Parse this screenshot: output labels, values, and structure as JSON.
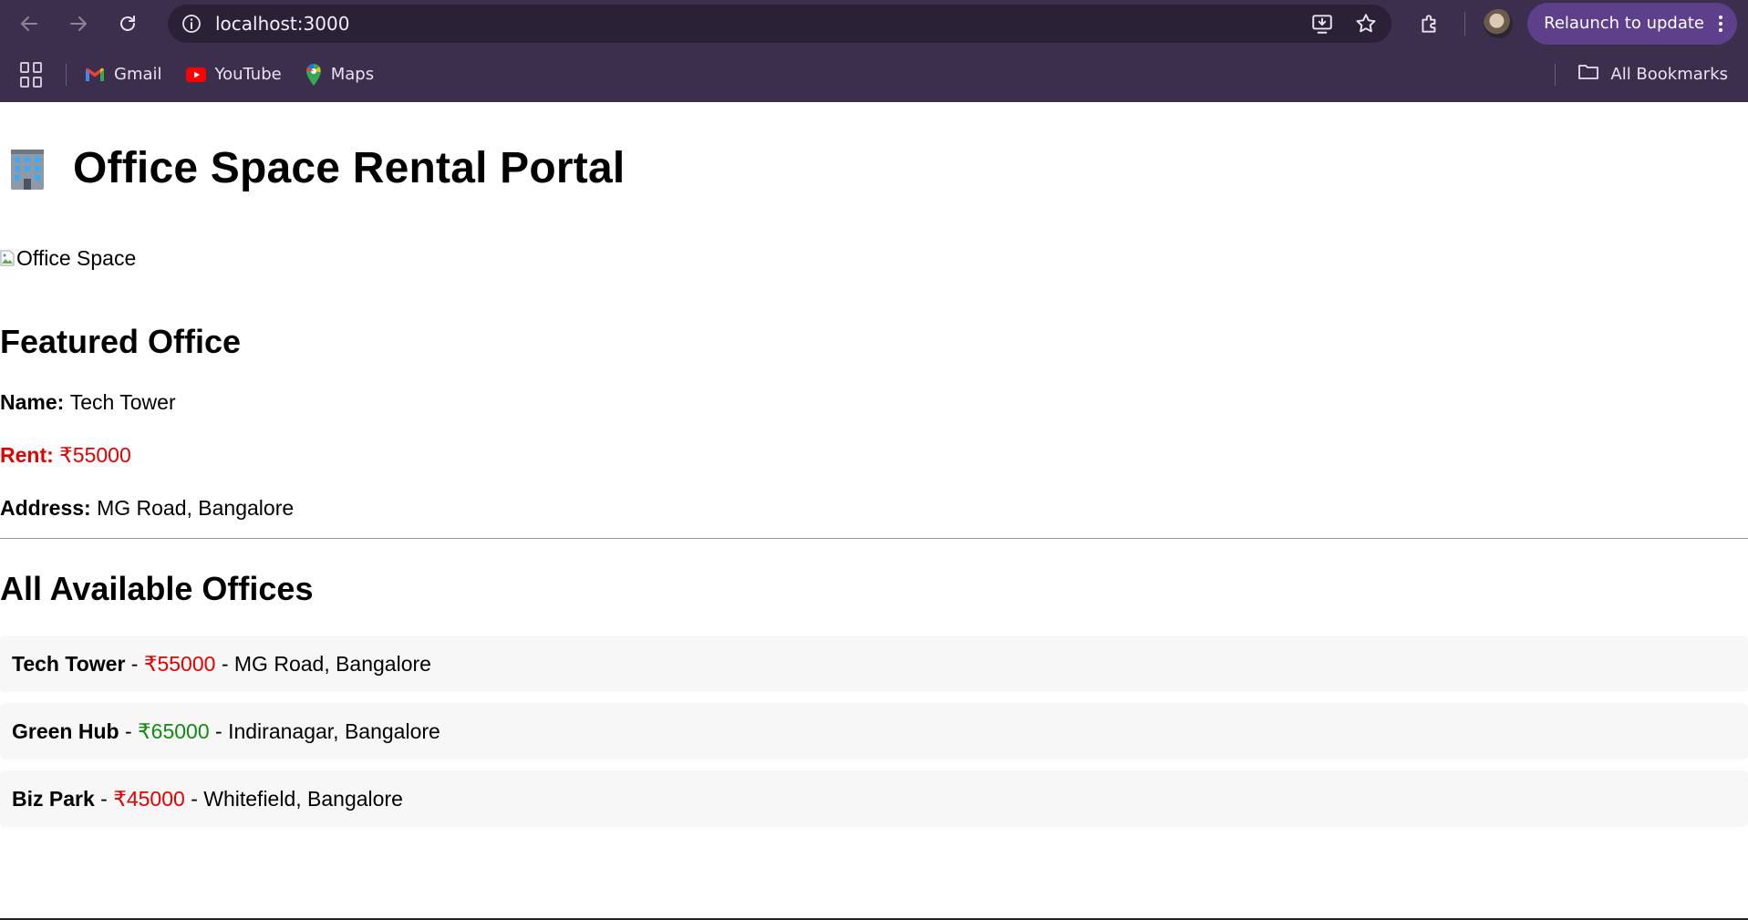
{
  "browser": {
    "url": "localhost:3000",
    "relaunch_label": "Relaunch to update",
    "bookmarks": [
      {
        "label": "Gmail",
        "icon": "gmail-icon"
      },
      {
        "label": "YouTube",
        "icon": "youtube-icon"
      },
      {
        "label": "Maps",
        "icon": "maps-icon"
      }
    ],
    "all_bookmarks_label": "All Bookmarks"
  },
  "page": {
    "title": "Office Space Rental Portal",
    "title_icon": "office-building-emoji",
    "image_alt": "Office Space",
    "featured": {
      "heading": "Featured Office",
      "name_label": "Name:",
      "name_value": "Tech Tower",
      "rent_label": "Rent:",
      "rent_value": "₹55000",
      "address_label": "Address:",
      "address_value": "MG Road, Bangalore"
    },
    "all_heading": "All Available Offices",
    "offices": [
      {
        "name": "Tech Tower",
        "price": "₹55000",
        "address": "MG Road, Bangalore",
        "price_color": "#e60000"
      },
      {
        "name": "Green Hub",
        "price": "₹65000",
        "address": "Indiranagar, Bangalore",
        "price_color": "#138a13"
      },
      {
        "name": "Biz Park",
        "price": "₹45000",
        "address": "Whitefield, Bangalore",
        "price_color": "#e60000"
      }
    ],
    "separator": " - "
  },
  "colors": {
    "chrome_bg": "#3c2f4d",
    "relaunch_bg": "#5d3f8c",
    "rent_red": "#e60000",
    "price_green": "#138a13",
    "row_bg": "#f7f7f7"
  }
}
